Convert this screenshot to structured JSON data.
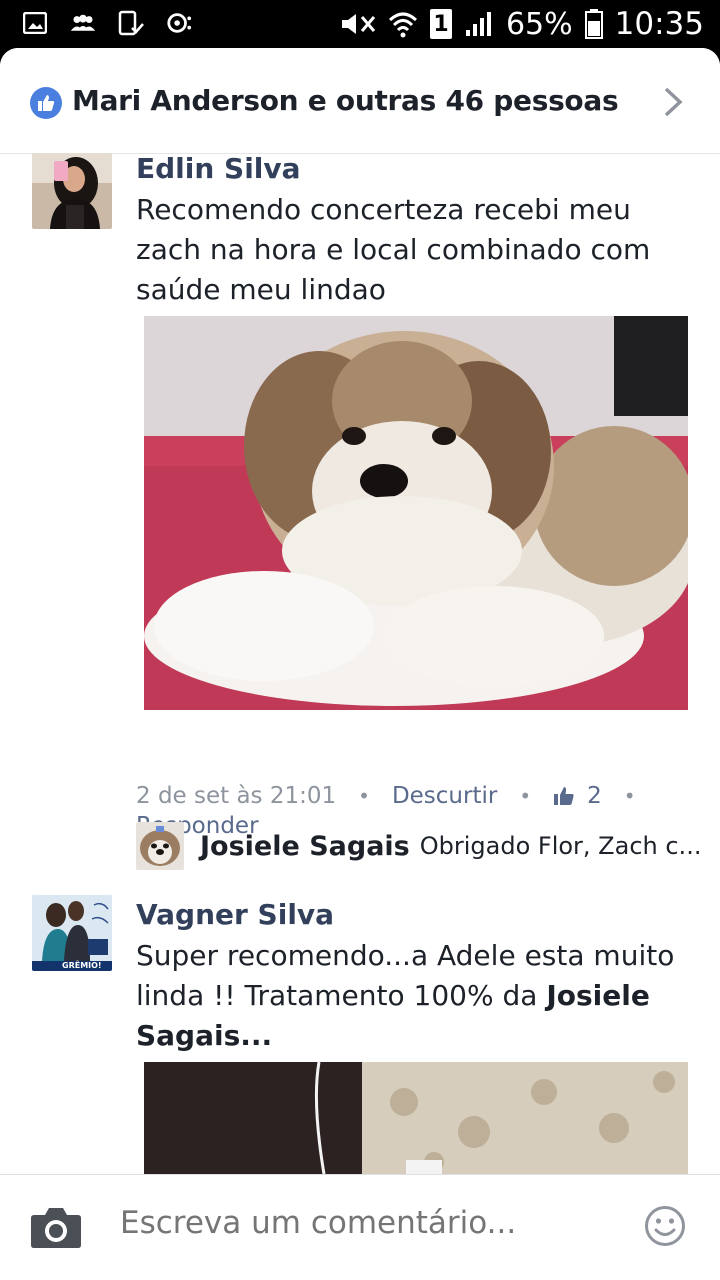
{
  "status_bar": {
    "battery": "65%",
    "time": "10:35",
    "sim": "1"
  },
  "header": {
    "title": "Mari Anderson e outras 46 pessoas"
  },
  "comments": [
    {
      "author": "Edlin Silva",
      "text": "Recomendo concerteza recebi meu zach na hora e local combinado com saúde meu lindao",
      "timestamp": "2 de set às 21:01",
      "unlike": "Descurtir",
      "likes": "2",
      "reply": "Responder",
      "replies": [
        {
          "author": "Josiele Sagais",
          "text": "Obrigado Flor, Zach c..."
        }
      ]
    },
    {
      "author": "Vagner Silva",
      "text_before": "Super recomendo...a Adele esta muito linda !! Tratamento 100% da",
      "mention": "Josiele Sagais...",
      "avatar_text": "GRÊMIO!"
    }
  ],
  "composer": {
    "placeholder": "Escreva um comentário..."
  },
  "colors": {
    "accent": "#4a7fe0",
    "author": "#33405c",
    "meta": "#8d949e",
    "link": "#5a6a8c"
  }
}
